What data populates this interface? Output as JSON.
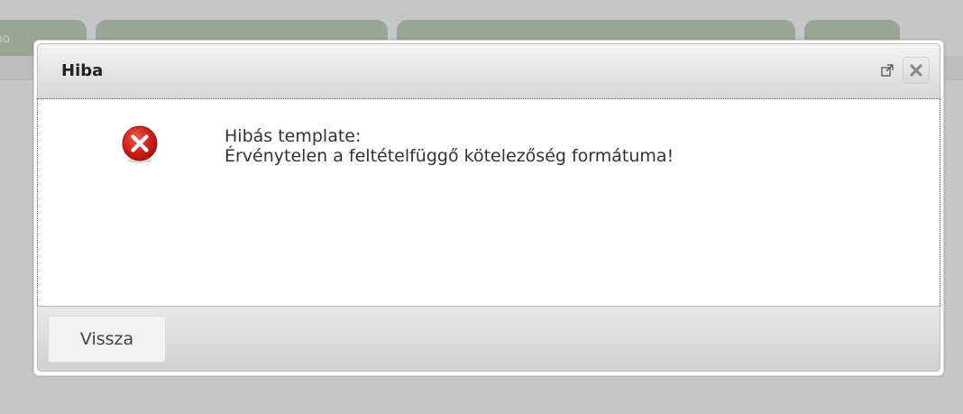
{
  "background": {
    "tab_fragment_label": "ao"
  },
  "dialog": {
    "title": "Hiba",
    "icons": {
      "popout": "external-link-icon",
      "close": "close-icon",
      "error": "error-circle-icon"
    },
    "message_line1": "Hibás template:",
    "message_line2": "Érvénytelen a feltételfüggő kötelezőség formátuma!",
    "back_button_label": "Vissza"
  },
  "colors": {
    "error_red": "#c8201c",
    "overlay_gray": "#c6c6c6",
    "tab_green": "#9aa593"
  }
}
